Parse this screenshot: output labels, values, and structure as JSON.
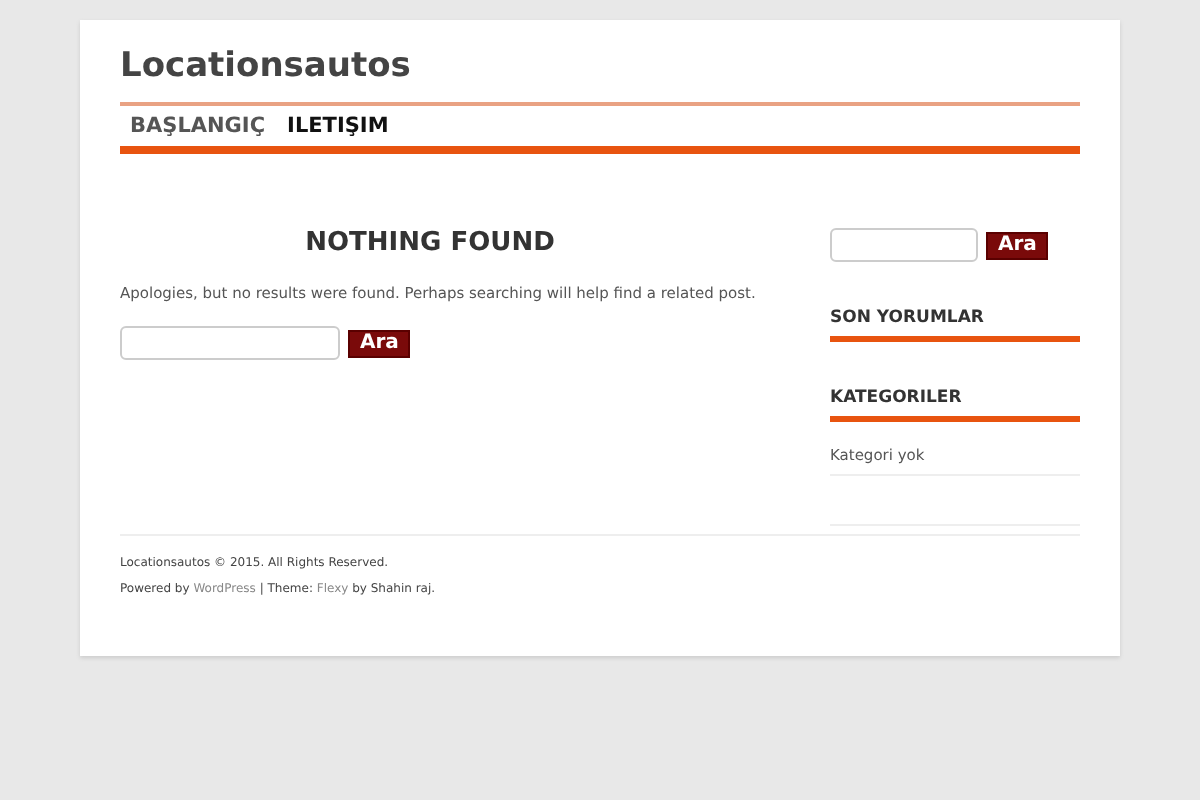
{
  "site_title": "Locationsautos",
  "nav": [
    {
      "label": "BAŞLANGIÇ",
      "selected": false
    },
    {
      "label": "ILETIŞIM",
      "selected": true
    }
  ],
  "main": {
    "heading": "NOTHING FOUND",
    "message": "Apologies, but no results were found. Perhaps searching will help find a related post.",
    "search_button": "Ara"
  },
  "sidebar": {
    "search_button": "Ara",
    "widgets": [
      {
        "title": "SON YORUMLAR"
      },
      {
        "title": "KATEGORILER",
        "items": [
          "Kategori yok"
        ]
      }
    ]
  },
  "footer": {
    "copyright": "Locationsautos © 2015. All Rights Reserved.",
    "credits": [
      {
        "kind": "text",
        "text": "Powered by "
      },
      {
        "kind": "link",
        "text": "WordPress"
      },
      {
        "kind": "text",
        "text": " | Theme: "
      },
      {
        "kind": "link",
        "text": "Flexy"
      },
      {
        "kind": "text",
        "text": " by Shahin raj."
      }
    ]
  }
}
